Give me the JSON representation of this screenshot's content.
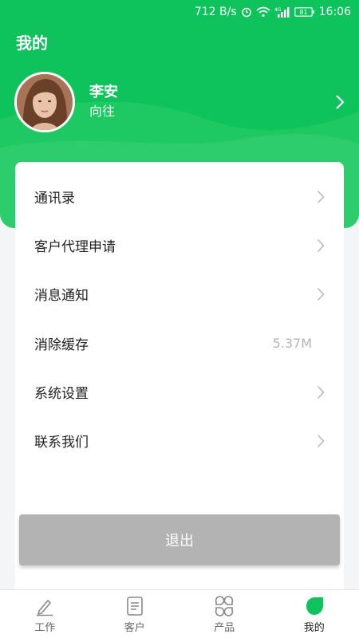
{
  "status_bar": {
    "speed": "712 B/s",
    "signal_type": "4G",
    "battery": "81",
    "time": "16:06"
  },
  "header": {
    "title": "我的",
    "user_name": "李安",
    "user_subtitle": "向往"
  },
  "menu": {
    "items": [
      {
        "label": "通讯录",
        "value": ""
      },
      {
        "label": "客户代理申请",
        "value": ""
      },
      {
        "label": "消息通知",
        "value": ""
      },
      {
        "label": "消除缓存",
        "value": "5.37M"
      },
      {
        "label": "系统设置",
        "value": ""
      },
      {
        "label": "联系我们",
        "value": ""
      }
    ],
    "logout_label": "退出"
  },
  "tabbar": {
    "tabs": [
      {
        "label": "工作",
        "icon": "pencil-icon"
      },
      {
        "label": "客户",
        "icon": "document-icon"
      },
      {
        "label": "产品",
        "icon": "grid-icon"
      },
      {
        "label": "我的",
        "icon": "leaf-icon"
      }
    ],
    "active_index": 3
  },
  "colors": {
    "brand_green": "#0fc35c",
    "logout_gray": "#b3b3b3",
    "background": "#f4f5f6"
  }
}
